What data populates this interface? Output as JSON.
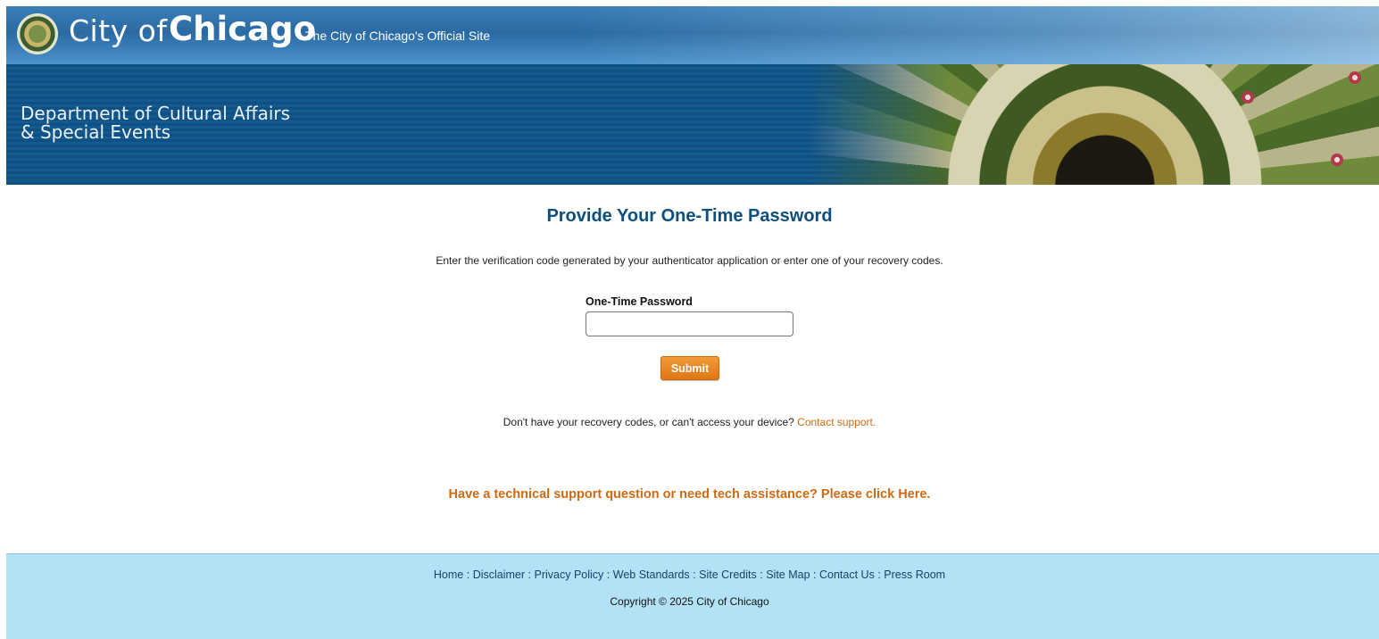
{
  "header": {
    "city_of": "City of",
    "chicago": "Chicago",
    "tagline": "The City of Chicago's Official Site",
    "department": "Department of Cultural Affairs\n& Special Events"
  },
  "main": {
    "title": "Provide Your One-Time Password",
    "instructions": "Enter the verification code generated by your authenticator application or enter one of your recovery codes.",
    "otp_label": "One-Time Password",
    "otp_value": "",
    "submit_label": "Submit",
    "help_text": "Don't have your recovery codes, or can't access your device?",
    "contact_support": "Contact support.",
    "tech_support": "Have a technical support question or need tech assistance? Please click Here."
  },
  "footer": {
    "links": [
      "Home",
      "Disclaimer",
      "Privacy Policy",
      "Web Standards",
      "Site Credits",
      "Site Map",
      "Contact Us",
      "Press Room"
    ],
    "separator": ":",
    "copyright": "Copyright © 2025 City of Chicago"
  },
  "colors": {
    "title_blue": "#0d4f7c",
    "accent_orange": "#d06a12",
    "button_orange": "#e07612",
    "footer_bg": "#b2e2f6",
    "banner_blue": "#135a90"
  }
}
